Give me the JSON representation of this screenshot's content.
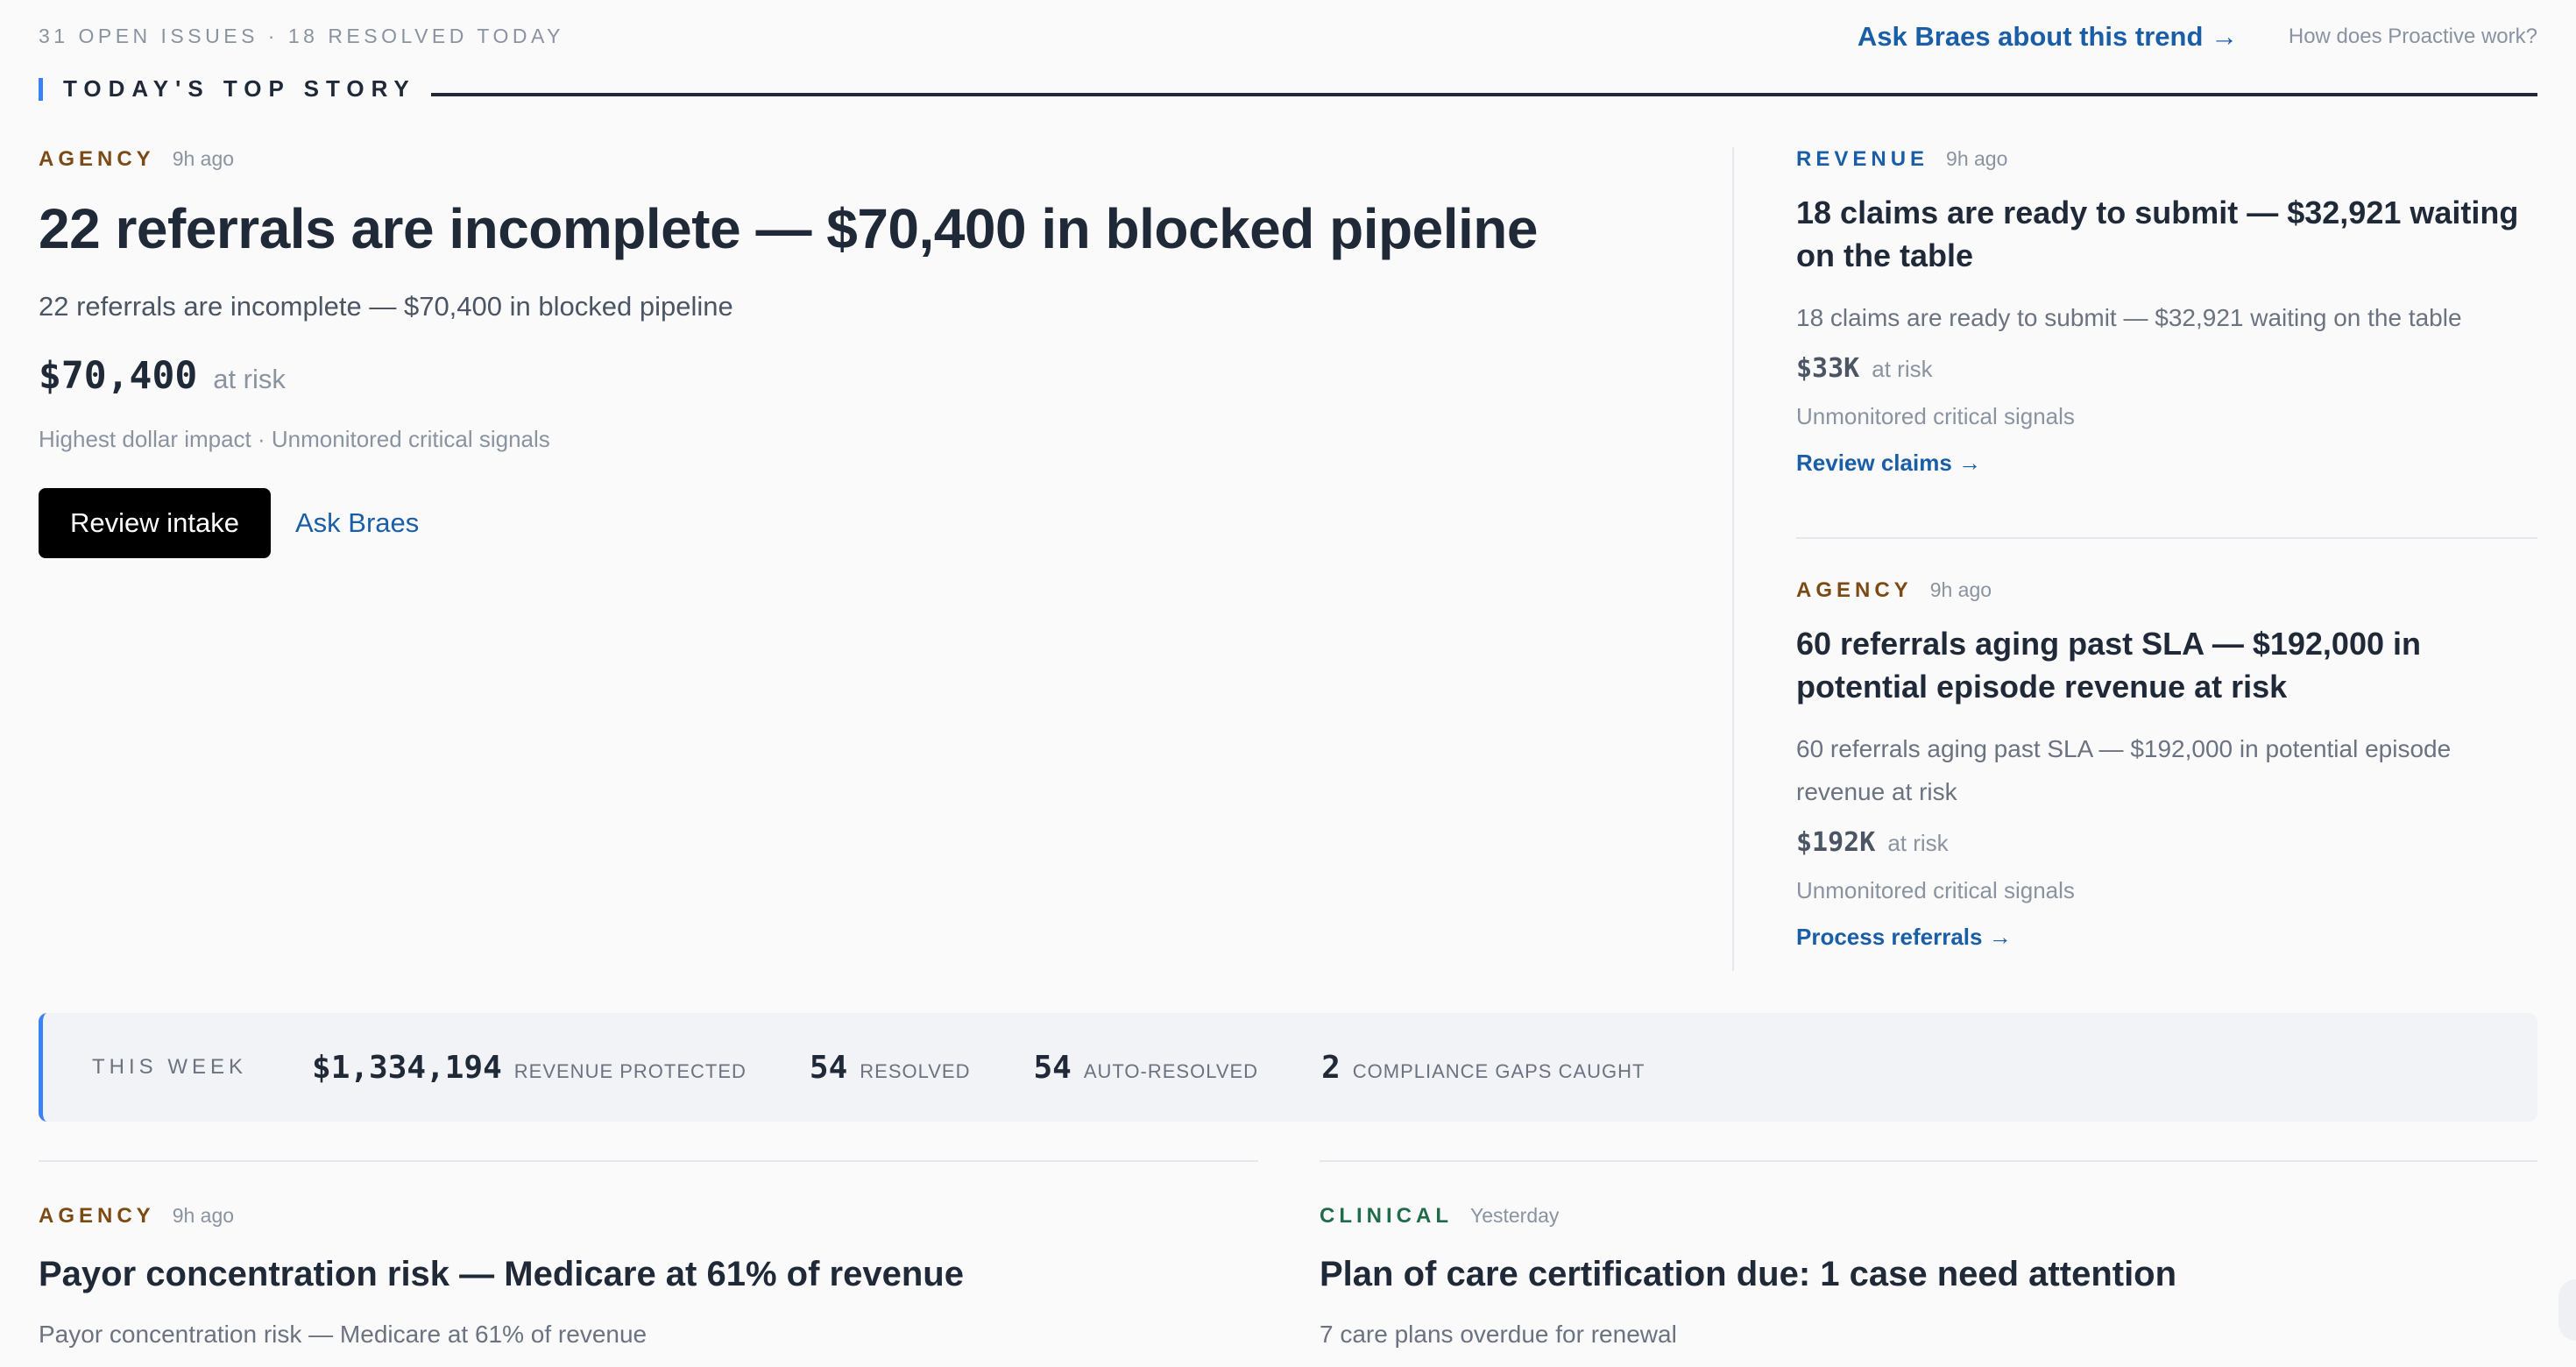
{
  "header": {
    "summary": "31 OPEN ISSUES · 18 RESOLVED TODAY",
    "ask_trend_link": "Ask Braes about this trend →",
    "how_proactive_link": "How does Proactive work?"
  },
  "section": {
    "title": "TODAY'S TOP STORY",
    "accent_color": "#3b82f6"
  },
  "lead_story": {
    "category": "AGENCY",
    "time": "9h ago",
    "title": "22 referrals are incomplete — $70,400 in blocked pipeline",
    "summary": "22 referrals are incomplete — $70,400 in blocked pipeline",
    "amount": "$70,400",
    "amount_suffix": "at risk",
    "signals": "Highest dollar impact · Unmonitored critical signals",
    "primary_action": "Review intake",
    "secondary_action": "Ask Braes"
  },
  "side_stories": [
    {
      "category": "REVENUE",
      "time": "9h ago",
      "title": "18 claims are ready to submit — $32,921 waiting on the table",
      "summary": "18 claims are ready to submit — $32,921 waiting on the table",
      "amount": "$33K",
      "amount_suffix": "at risk",
      "signals": "Unmonitored critical signals",
      "action": "Review claims →"
    },
    {
      "category": "AGENCY",
      "time": "9h ago",
      "title": "60 referrals aging past SLA — $192,000 in potential episode revenue at risk",
      "summary": "60 referrals aging past SLA — $192,000 in potential episode revenue at risk",
      "amount": "$192K",
      "amount_suffix": "at risk",
      "signals": "Unmonitored critical signals",
      "action": "Process referrals →"
    }
  ],
  "this_week": {
    "label": "THIS WEEK",
    "stats": [
      {
        "value": "$1,334,194",
        "label": "REVENUE PROTECTED"
      },
      {
        "value": "54",
        "label": "RESOLVED"
      },
      {
        "value": "54",
        "label": "AUTO-RESOLVED"
      },
      {
        "value": "2",
        "label": "COMPLIANCE GAPS CAUGHT"
      }
    ]
  },
  "bottom_cards": [
    {
      "category": "AGENCY",
      "time": "9h ago",
      "title": "Payor concentration risk — Medicare at 61% of revenue",
      "summary": "Payor concentration risk — Medicare at 61% of revenue"
    },
    {
      "category": "CLINICAL",
      "time": "Yesterday",
      "title": "Plan of care certification due: 1 case need attention",
      "summary": "7 care plans overdue for renewal"
    }
  ],
  "colors": {
    "agency": "#7c4a14",
    "revenue": "#1a5ea8",
    "clinical": "#1f6b4a",
    "link": "#1a5ea8"
  }
}
